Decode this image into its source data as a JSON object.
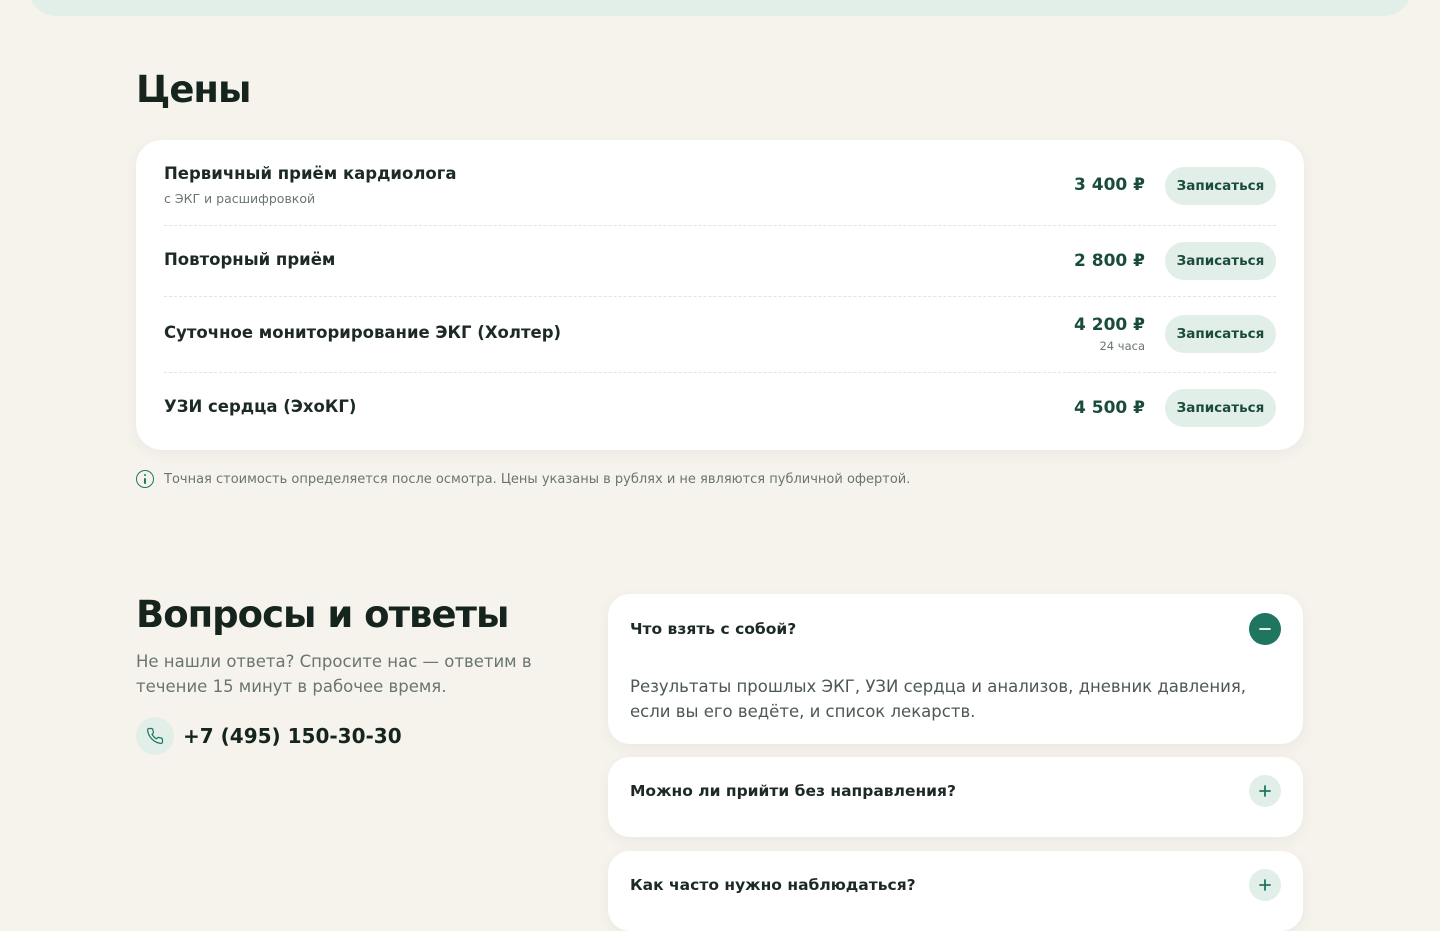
{
  "prices": {
    "title": "Цены",
    "items": [
      {
        "name": "Первичный приём кардиолога",
        "note": "с ЭКГ и расшифровкой",
        "price": "3 400 ₽",
        "duration": "",
        "button": "Записаться"
      },
      {
        "name": "Повторный приём",
        "note": "",
        "price": "2 800 ₽",
        "duration": "",
        "button": "Записаться"
      },
      {
        "name": "Суточное мониторирование ЭКГ (Холтер)",
        "note": "",
        "price": "4 200 ₽",
        "duration": "24 часа",
        "button": "Записаться"
      },
      {
        "name": "УЗИ сердца (ЭхоКГ)",
        "note": "",
        "price": "4 500 ₽",
        "duration": "",
        "button": "Записаться"
      }
    ],
    "disclaimer": "Точная стоимость определяется после осмотра. Цены указаны в рублях и не являются публичной офертой."
  },
  "faq": {
    "title": "Вопросы и ответы",
    "subtitle": "Не нашли ответа? Спросите нас — ответим в течение 15 минут в рабочее время.",
    "phone": "+7 (495) 150-30-30",
    "items": [
      {
        "question": "Что взять с собой?",
        "answer": "Результаты прошлых ЭКГ, УЗИ сердца и анализов, дневник давления, если вы его ведёте, и список лекарств.",
        "expanded": true
      },
      {
        "question": "Можно ли прийти без направления?",
        "answer": "",
        "expanded": false
      },
      {
        "question": "Как часто нужно наблюдаться?",
        "answer": "",
        "expanded": false
      }
    ]
  },
  "colors": {
    "background": "#f6f3ec",
    "accent": "#1e7560",
    "accent_light": "#e2efe8",
    "heading": "#16241e"
  },
  "icons": {
    "info": "info-circle-icon",
    "phone": "phone-icon",
    "collapse": "minus-icon",
    "expand": "plus-icon"
  }
}
